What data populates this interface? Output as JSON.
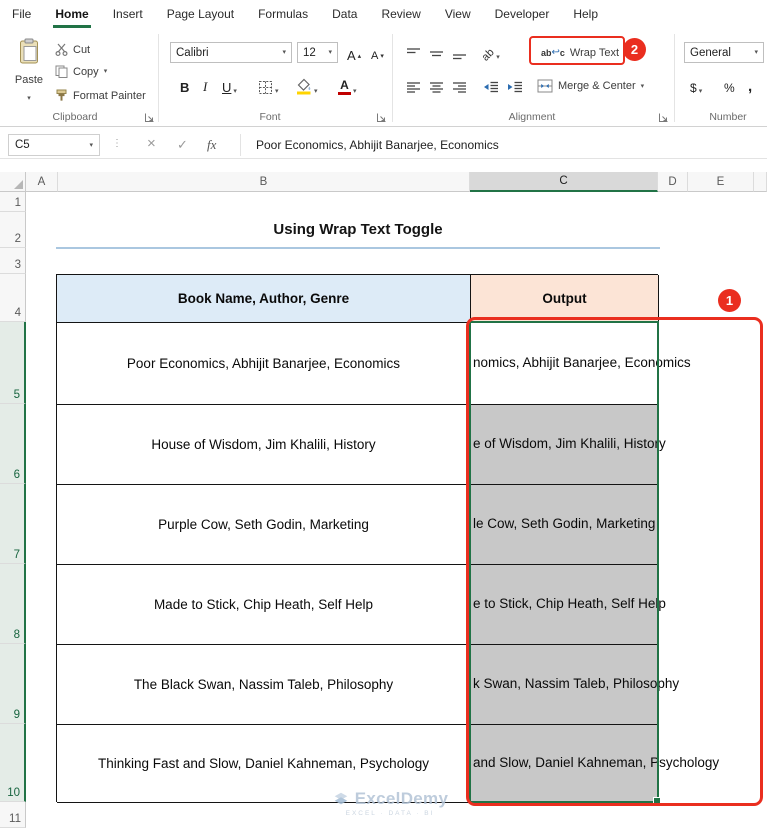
{
  "menu": {
    "items": [
      "File",
      "Home",
      "Insert",
      "Page Layout",
      "Formulas",
      "Data",
      "Review",
      "View",
      "Developer",
      "Help"
    ]
  },
  "ribbon": {
    "clipboard": {
      "label": "Clipboard",
      "paste": "Paste",
      "cut": "Cut",
      "copy": "Copy",
      "format_painter": "Format Painter"
    },
    "font": {
      "label": "Font",
      "name": "Calibri",
      "size": "12",
      "bold": "B",
      "italic": "I",
      "underline": "U"
    },
    "alignment": {
      "label": "Alignment",
      "wrap_text": "Wrap Text",
      "merge_center": "Merge & Center"
    },
    "number": {
      "label": "Number",
      "format": "General",
      "currency": "$",
      "percent": "%",
      "comma": ","
    }
  },
  "formula_bar": {
    "name_box": "C5",
    "dots": "⋮",
    "cancel": "×",
    "enter": "✓",
    "fx": "fx",
    "formula": "Poor Economics, Abhijit Banarjee, Economics"
  },
  "sheet": {
    "columns": [
      "A",
      "B",
      "C",
      "D",
      "E"
    ],
    "rows": [
      "1",
      "2",
      "3",
      "4",
      "5",
      "6",
      "7",
      "8",
      "9",
      "10",
      "11"
    ],
    "selected_column": "C",
    "selected_range": "C5:C10",
    "title": "Using Wrap Text Toggle",
    "table": {
      "header_book": "Book Name, Author, Genre",
      "header_output": "Output",
      "rows": [
        {
          "book": "Poor Economics, Abhijit Banarjee, Economics",
          "output": "nomics, Abhijit Banarjee, Economics"
        },
        {
          "book": "House of Wisdom, Jim Khalili, History",
          "output": "e of Wisdom, Jim Khalili, History"
        },
        {
          "book": "Purple Cow, Seth Godin, Marketing",
          "output": "le Cow, Seth Godin, Marketing"
        },
        {
          "book": "Made to Stick, Chip Heath, Self Help",
          "output": "e to Stick, Chip Heath, Self Help"
        },
        {
          "book": "The Black Swan, Nassim Taleb, Philosophy",
          "output": "k Swan, Nassim Taleb, Philosophy"
        },
        {
          "book": "Thinking Fast and Slow, Daniel Kahneman, Psychology",
          "output": "and Slow, Daniel Kahneman, Psychology"
        }
      ]
    }
  },
  "annotations": {
    "step1": "1",
    "step2": "2"
  },
  "watermark": {
    "name": "ExcelDemy",
    "tagline": "EXCEL · DATA · BI"
  },
  "icons": {
    "chevron": "▾",
    "up": "▴",
    "down": "▾",
    "A": "A",
    "wrap_ab": "ab",
    "wrap_c": "c",
    "wrap_arrow": "↩"
  },
  "colors": {
    "accent_green": "#217346",
    "annotation_red": "#ea2e1f",
    "header_blue": "#ddebf7",
    "header_peach": "#fce4d6",
    "selection_gray": "#c8c8c8"
  }
}
